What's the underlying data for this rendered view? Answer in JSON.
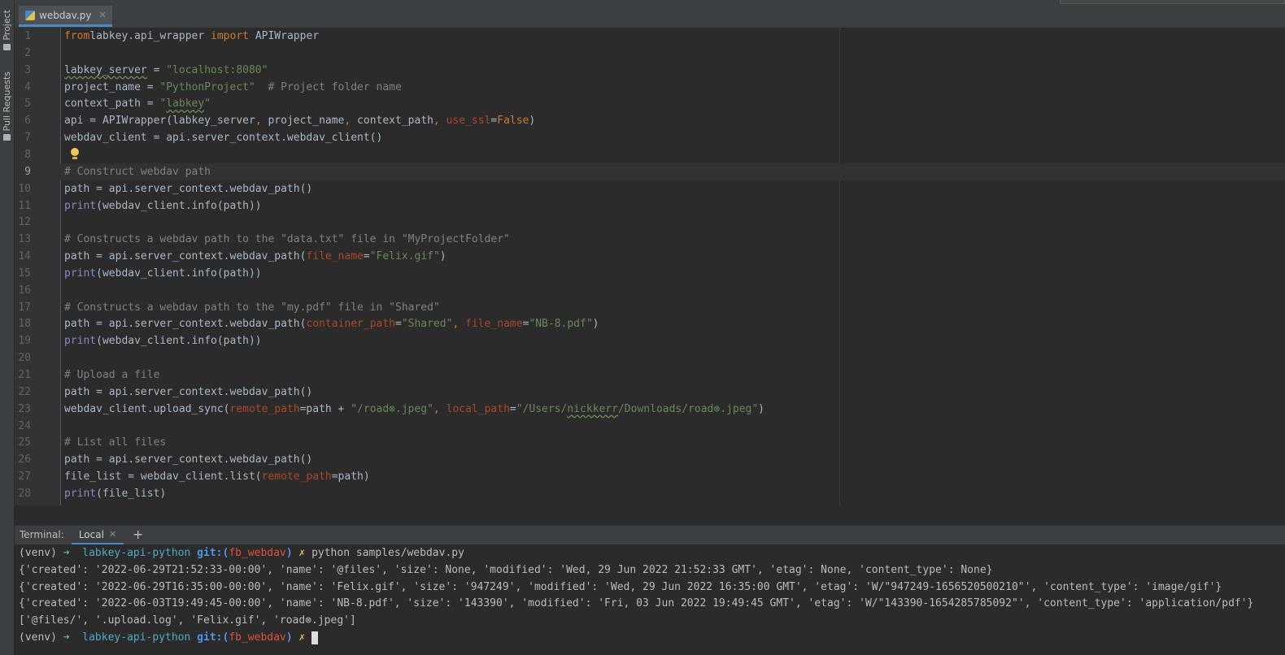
{
  "side_panel": {
    "project_label": "Project",
    "pull_requests_label": "Pull Requests"
  },
  "tabs": [
    {
      "label": "webdav.py",
      "close": "✕"
    }
  ],
  "editor": {
    "lines": [
      {
        "n": "1",
        "tokens": [
          [
            "kw",
            "from"
          ],
          [
            "",
            "labkey.api_wrapper "
          ],
          [
            "kw",
            "import"
          ],
          [
            "",
            " APIWrapper"
          ]
        ]
      },
      {
        "n": "2",
        "tokens": []
      },
      {
        "n": "3",
        "tokens": [
          [
            "squig",
            "labkey_server"
          ],
          [
            "",
            " = "
          ],
          [
            "str",
            "\"localhost:8080\""
          ]
        ]
      },
      {
        "n": "4",
        "tokens": [
          [
            "",
            "project_name = "
          ],
          [
            "str",
            "\"PythonProject\""
          ],
          [
            "",
            "  "
          ],
          [
            "cmt",
            "# Project folder name"
          ]
        ]
      },
      {
        "n": "5",
        "tokens": [
          [
            "",
            "context_path = "
          ],
          [
            "str",
            "\""
          ],
          [
            "str squig",
            "labkey"
          ],
          [
            "str",
            "\""
          ]
        ]
      },
      {
        "n": "6",
        "tokens": [
          [
            "",
            "api = APIWrapper(labkey_server"
          ],
          [
            "kw",
            ", "
          ],
          [
            "",
            "project_name"
          ],
          [
            "kw",
            ", "
          ],
          [
            "",
            "context_path"
          ],
          [
            "kw",
            ", "
          ],
          [
            "param",
            "use_ssl"
          ],
          [
            "",
            "="
          ],
          [
            "kw",
            "False"
          ],
          [
            "",
            ")"
          ]
        ]
      },
      {
        "n": "7",
        "tokens": [
          [
            "",
            "webdav_client = api.server_context.webdav_client()"
          ]
        ]
      },
      {
        "n": "8",
        "tokens": []
      },
      {
        "n": "9",
        "tokens": [
          [
            "cmt",
            "# Construct webdav path"
          ]
        ],
        "current": true
      },
      {
        "n": "10",
        "tokens": [
          [
            "",
            "path = api.server_context.webdav_path()"
          ]
        ]
      },
      {
        "n": "11",
        "tokens": [
          [
            "builtin",
            "print"
          ],
          [
            "",
            "(webdav_client.info(path))"
          ]
        ]
      },
      {
        "n": "12",
        "tokens": []
      },
      {
        "n": "13",
        "tokens": [
          [
            "cmt",
            "# Constructs a webdav path to the \"data.txt\" file in \"MyProjectFolder\""
          ]
        ]
      },
      {
        "n": "14",
        "tokens": [
          [
            "",
            "path = api.server_context.webdav_path("
          ],
          [
            "param",
            "file_name"
          ],
          [
            "",
            "="
          ],
          [
            "str",
            "\"Felix.gif\""
          ],
          [
            "",
            ")"
          ]
        ]
      },
      {
        "n": "15",
        "tokens": [
          [
            "builtin",
            "print"
          ],
          [
            "",
            "(webdav_client.info(path))"
          ]
        ]
      },
      {
        "n": "16",
        "tokens": []
      },
      {
        "n": "17",
        "tokens": [
          [
            "cmt",
            "# Constructs a webdav path to the \"my.pdf\" file in \"Shared\""
          ]
        ]
      },
      {
        "n": "18",
        "tokens": [
          [
            "",
            "path = api.server_context.webdav_path("
          ],
          [
            "param",
            "container_path"
          ],
          [
            "",
            "="
          ],
          [
            "str",
            "\"Shared\""
          ],
          [
            "kw",
            ", "
          ],
          [
            "param",
            "file_name"
          ],
          [
            "",
            "="
          ],
          [
            "str",
            "\"NB-8.pdf\""
          ],
          [
            "",
            ")"
          ]
        ]
      },
      {
        "n": "19",
        "tokens": [
          [
            "builtin",
            "print"
          ],
          [
            "",
            "(webdav_client.info(path))"
          ]
        ]
      },
      {
        "n": "20",
        "tokens": []
      },
      {
        "n": "21",
        "tokens": [
          [
            "cmt",
            "# Upload a file"
          ]
        ]
      },
      {
        "n": "22",
        "tokens": [
          [
            "",
            "path = api.server_context.webdav_path()"
          ]
        ]
      },
      {
        "n": "23",
        "tokens": [
          [
            "",
            "webdav_client.upload_sync("
          ],
          [
            "param",
            "remote_path"
          ],
          [
            "",
            "=path + "
          ],
          [
            "str",
            "\"/road⊗.jpeg\""
          ],
          [
            "kw",
            ", "
          ],
          [
            "param",
            "local_path"
          ],
          [
            "",
            "="
          ],
          [
            "str",
            "\"/Users/"
          ],
          [
            "str squig",
            "nickkerr"
          ],
          [
            "str",
            "/Downloads/road⊗.jpeg\""
          ],
          [
            "",
            ")"
          ]
        ]
      },
      {
        "n": "24",
        "tokens": []
      },
      {
        "n": "25",
        "tokens": [
          [
            "cmt",
            "# List all files"
          ]
        ]
      },
      {
        "n": "26",
        "tokens": [
          [
            "",
            "path = api.server_context.webdav_path()"
          ]
        ]
      },
      {
        "n": "27",
        "tokens": [
          [
            "",
            "file_list = webdav_client.list("
          ],
          [
            "param",
            "remote_path"
          ],
          [
            "",
            "=path)"
          ]
        ]
      },
      {
        "n": "28",
        "tokens": [
          [
            "builtin",
            "print"
          ],
          [
            "",
            "(file_list)"
          ]
        ]
      }
    ]
  },
  "terminal": {
    "title": "Terminal:",
    "tab_label": "Local",
    "tab_close": "✕",
    "add_label": "+",
    "lines": [
      [
        [
          "",
          "(venv) "
        ],
        [
          "t-green",
          "➜  "
        ],
        [
          "t-cyan",
          "labkey-api-python "
        ],
        [
          "t-blue",
          "git:("
        ],
        [
          "t-red",
          "fb_webdav"
        ],
        [
          "t-blue",
          ")"
        ],
        [
          "t-yellow",
          " ✗ "
        ],
        [
          "",
          "python samples/webdav.py"
        ]
      ],
      [
        [
          "",
          "{'created': '2022-06-29T21:52:33-00:00', 'name': '@files', 'size': None, 'modified': 'Wed, 29 Jun 2022 21:52:33 GMT', 'etag': None, 'content_type': None}"
        ]
      ],
      [
        [
          "",
          "{'created': '2022-06-29T16:35:00-00:00', 'name': 'Felix.gif', 'size': '947249', 'modified': 'Wed, 29 Jun 2022 16:35:00 GMT', 'etag': 'W/\"947249-1656520500210\"', 'content_type': 'image/gif'}"
        ]
      ],
      [
        [
          "",
          "{'created': '2022-06-03T19:49:45-00:00', 'name': 'NB-8.pdf', 'size': '143390', 'modified': 'Fri, 03 Jun 2022 19:49:45 GMT', 'etag': 'W/\"143390-1654285785092\"', 'content_type': 'application/pdf'}"
        ]
      ],
      [
        [
          "",
          "['@files/', '.upload.log', 'Felix.gif', 'road⊗.jpeg']"
        ]
      ],
      [
        [
          "",
          "(venv) "
        ],
        [
          "t-green",
          "➜  "
        ],
        [
          "t-cyan",
          "labkey-api-python "
        ],
        [
          "t-blue",
          "git:("
        ],
        [
          "t-red",
          "fb_webdav"
        ],
        [
          "t-blue",
          ")"
        ],
        [
          "t-yellow",
          " ✗ "
        ]
      ]
    ]
  },
  "colors": {
    "editor_bg": "#2b2b2b",
    "keyword": "#cc7832",
    "string": "#6a8759",
    "comment": "#808080",
    "builtin": "#8888c6",
    "param": "#aa4926",
    "accent": "#4a88c7"
  }
}
